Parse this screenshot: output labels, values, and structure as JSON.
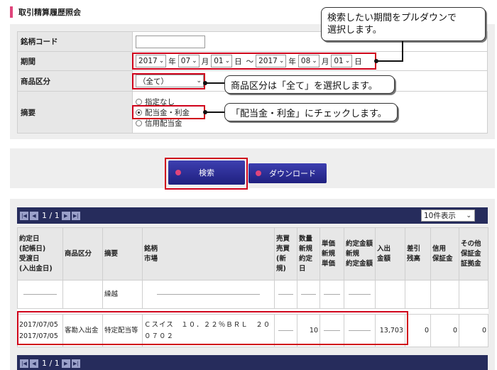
{
  "page_title": "取引精算履歴照会",
  "form": {
    "code_label": "銘柄コード",
    "code_value": "",
    "period_label": "期間",
    "from_year": "2017",
    "from_month": "07",
    "from_day": "01",
    "to_year": "2017",
    "to_month": "08",
    "to_day": "01",
    "unit_year": "年",
    "unit_month": "月",
    "unit_day": "日",
    "tilde": "～",
    "category_label": "商品区分",
    "category_value": "（全て）",
    "summary_label": "摘要",
    "radio_options": [
      "指定なし",
      "配当金・利金",
      "信用配当金"
    ],
    "radio_selected": "配当金・利金"
  },
  "callouts": {
    "period": "検索したい期間をプルダウンで\n選択します。",
    "category": "商品区分は「全て」を選択します。",
    "summary": "「配当金・利金」にチェックします。"
  },
  "buttons": {
    "search": "検索",
    "download": "ダウンロード"
  },
  "pager": {
    "page_info": "1 / 1",
    "per_page": "10件表示"
  },
  "table": {
    "headers": {
      "date": [
        "約定日",
        "(記帳日)",
        "受渡日",
        "(入出金日)"
      ],
      "category": "商品区分",
      "summary": "摘要",
      "issue": [
        "銘柄",
        "市場"
      ],
      "trade": [
        "売買",
        "売買",
        "(新規)"
      ],
      "qty": [
        "数量",
        "新規",
        "約定日"
      ],
      "price": [
        "単価",
        "新規",
        "単価"
      ],
      "amount": [
        "約定金額",
        "新規",
        "約定金額"
      ],
      "inout": [
        "入出",
        "金額"
      ],
      "balance": [
        "差引",
        "残高"
      ],
      "margin": [
        "信用",
        "保証金"
      ],
      "other": [
        "その他",
        "保証金",
        "証拠金"
      ]
    },
    "carry_row": {
      "summary": "繰越"
    },
    "row": {
      "date1": "2017/07/05",
      "date2": "2017/07/05",
      "category": "客勘入出金",
      "summary": "特定配当等",
      "issue": "Ｃスイス　１０．２２％ＢＲＬ　２００７０２",
      "qty": "10",
      "inout": "13,703",
      "balance": "0",
      "margin": "0",
      "other": "0"
    }
  }
}
